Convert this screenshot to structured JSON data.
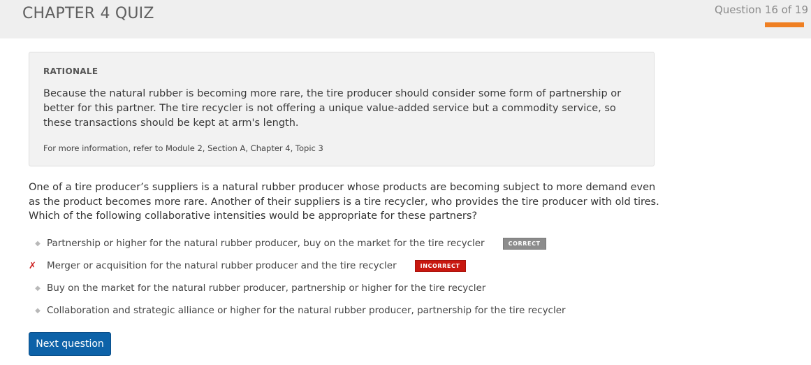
{
  "header": {
    "title": "CHAPTER 4 QUIZ",
    "progress_text": "Question 16 of 19",
    "progress_fraction": 0.842,
    "accent_color": "#ef7f22"
  },
  "rationale": {
    "heading": "RATIONALE",
    "body": "Because the natural rubber is becoming more rare, the tire producer should consider some form of partnership or better for this partner. The tire recycler is not offering a unique value-added service but a commodity service, so these transactions should be kept at arm's length.",
    "reference": "For more information, refer to Module 2, Section A, Chapter 4, Topic 3"
  },
  "question": {
    "text": "One of a tire producer’s suppliers is a natural rubber producer whose products are becoming subject to more demand even as the product becomes more rare. Another of their suppliers is a tire recycler, who provides the tire producer with old tires. Which of the following collaborative intensities would be appropriate for these partners?"
  },
  "options": [
    {
      "marker": "◆",
      "marker_icon": "diamond-bullet-icon",
      "text": "Partnership or higher for the natural rubber producer, buy on the market for the tire recycler",
      "badge": "CORRECT"
    },
    {
      "marker": "✗",
      "marker_icon": "cross-mark-icon",
      "text": "Merger or acquisition for the natural rubber producer and the tire recycler",
      "badge": "INCORRECT"
    },
    {
      "marker": "◆",
      "marker_icon": "diamond-bullet-icon",
      "text": "Buy on the market for the natural rubber producer, partnership or higher for the tire recycler",
      "badge": ""
    },
    {
      "marker": "◆",
      "marker_icon": "diamond-bullet-icon",
      "text": "Collaboration and strategic alliance or higher for the natural rubber producer, partnership for the tire recycler",
      "badge": ""
    }
  ],
  "next_button": {
    "label": "Next question"
  },
  "colors": {
    "correct_badge": "#8c8c8c",
    "incorrect_badge": "#c8170f",
    "button": "#0d62a8"
  }
}
